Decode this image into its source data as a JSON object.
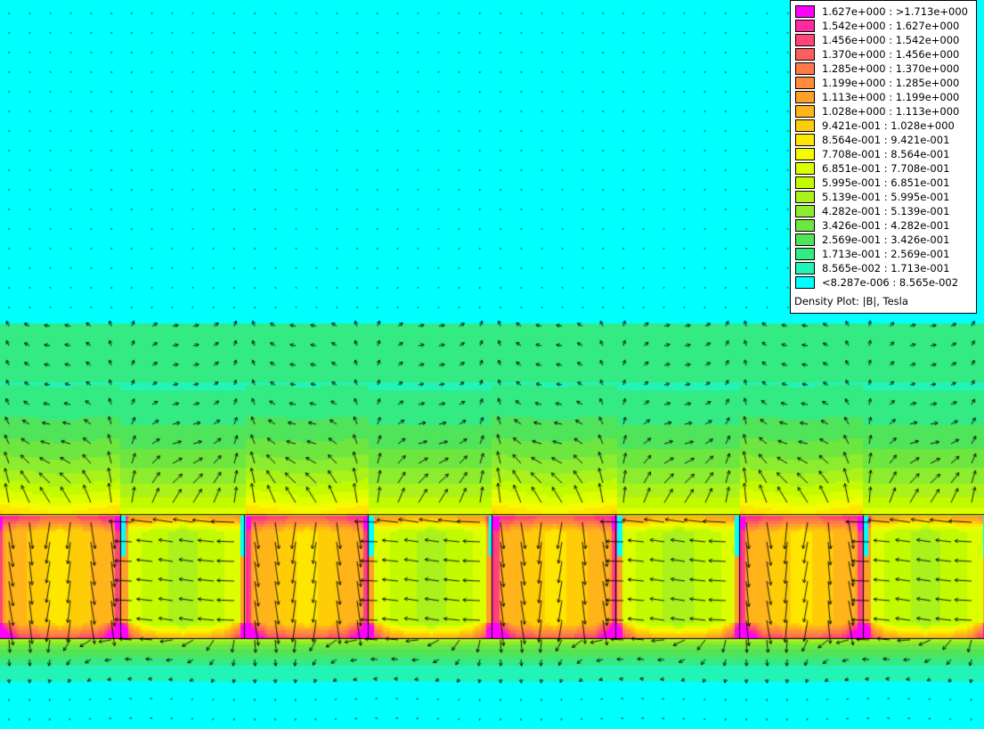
{
  "legend": {
    "title": "Density Plot: |B|, Tesla",
    "entries": [
      {
        "label": "1.627e+000 : >1.713e+000",
        "color": "#ff00ff"
      },
      {
        "label": "1.542e+000 : 1.627e+000",
        "color": "#ff2a9e"
      },
      {
        "label": "1.456e+000 : 1.542e+000",
        "color": "#ff4478"
      },
      {
        "label": "1.370e+000 : 1.456e+000",
        "color": "#ff5e5e"
      },
      {
        "label": "1.285e+000 : 1.370e+000",
        "color": "#ff7a48"
      },
      {
        "label": "1.199e+000 : 1.285e+000",
        "color": "#ff8c3a"
      },
      {
        "label": "1.113e+000 : 1.199e+000",
        "color": "#ffa028"
      },
      {
        "label": "1.028e+000 : 1.113e+000",
        "color": "#ffb41a"
      },
      {
        "label": "9.421e-001 : 1.028e+000",
        "color": "#ffcc08"
      },
      {
        "label": "8.564e-001 : 9.421e-001",
        "color": "#ffe600"
      },
      {
        "label": "7.708e-001 : 8.564e-001",
        "color": "#f4fa00"
      },
      {
        "label": "6.851e-001 : 7.708e-001",
        "color": "#dcff00"
      },
      {
        "label": "5.995e-001 : 6.851e-001",
        "color": "#c2fa00"
      },
      {
        "label": "5.139e-001 : 5.995e-001",
        "color": "#aaf21a"
      },
      {
        "label": "4.282e-001 : 5.139e-001",
        "color": "#8cec2e"
      },
      {
        "label": "3.426e-001 : 4.282e-001",
        "color": "#6ee640"
      },
      {
        "label": "2.569e-001 : 3.426e-001",
        "color": "#50e45a"
      },
      {
        "label": "1.713e-001 : 2.569e-001",
        "color": "#34ea82"
      },
      {
        "label": "8.565e-002 : 1.713e-001",
        "color": "#22f4b8"
      },
      {
        "label": "<8.287e-006 : 8.565e-002",
        "color": "#00ffff"
      }
    ]
  }
}
